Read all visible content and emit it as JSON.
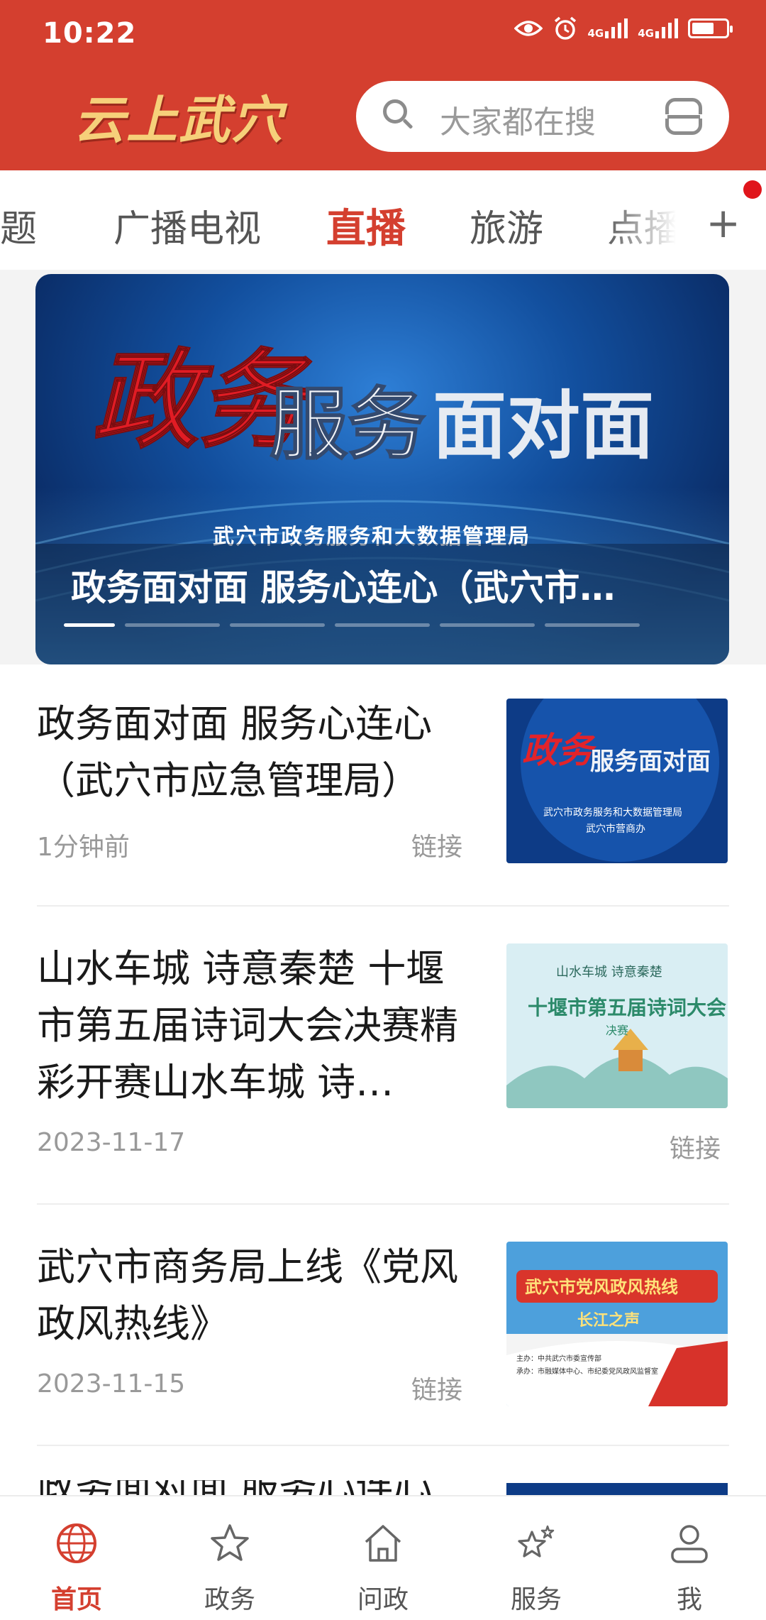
{
  "status_bar": {
    "time": "10:22",
    "signal1": "4G",
    "signal2": "4G"
  },
  "header": {
    "logo_text": "云上武穴",
    "search_placeholder": "大家都在搜"
  },
  "tabs": [
    {
      "label": "专题"
    },
    {
      "label": "广播电视"
    },
    {
      "label": "直播",
      "active": true
    },
    {
      "label": "旅游"
    },
    {
      "label": "点播"
    }
  ],
  "banner": {
    "art_title_red": "政务",
    "art_title_white": "服务",
    "art_title_face": "面对面",
    "art_sub1": "武穴市政务服务和大数据管理局",
    "caption": "政务面对面 服务心连心（武穴市…",
    "page_index": 1,
    "page_count": 6
  },
  "news": [
    {
      "title": "政务面对面 服务心连心（武穴市应急管理局）",
      "time": "1分钟前",
      "tag": "链接",
      "thumb": {
        "red": "政务",
        "white": "服务面对面",
        "sub": "武穴市政务服务和大数据管理局",
        "sub2": "武穴市营商办"
      }
    },
    {
      "title": "山水车城 诗意秦楚 十堰市第五届诗词大会决赛精彩开赛山水车城 诗…",
      "time": "2023-11-17",
      "tag": "链接",
      "thumb": {
        "top": "山水车城 诗意秦楚",
        "main": "十堰市第五届诗词大会",
        "sub": "决赛"
      }
    },
    {
      "title": "武穴市商务局上线《党风政风热线》",
      "time": "2023-11-15",
      "tag": "链接",
      "thumb": {
        "main": "武穴市党风政风热线",
        "sub": "长江之声",
        "org1": "主办：中共武穴市委宣传部",
        "org2": "承办：市融媒体中心、市纪委党风政风监督室"
      }
    }
  ],
  "bottom_nav": [
    {
      "label": "首页",
      "icon": "globe-icon",
      "active": true
    },
    {
      "label": "政务",
      "icon": "star-icon"
    },
    {
      "label": "问政",
      "icon": "home-icon"
    },
    {
      "label": "服务",
      "icon": "stars-icon"
    },
    {
      "label": "我",
      "icon": "user-icon"
    }
  ],
  "colors": {
    "brand_red": "#d43f2f",
    "notify_dot": "#e0151b"
  }
}
